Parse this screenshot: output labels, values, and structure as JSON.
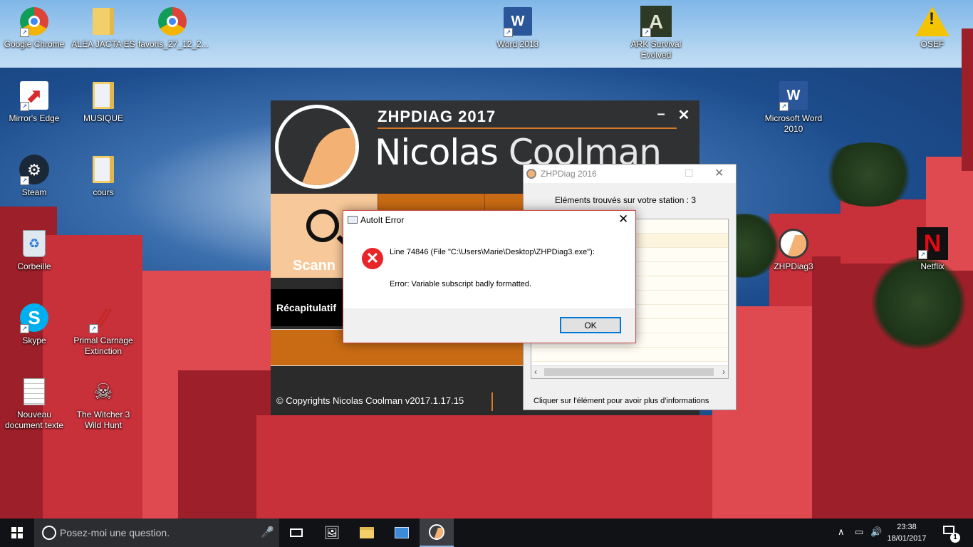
{
  "desktop_icons": [
    {
      "label": "Google Chrome",
      "icon": "chrome-icon"
    },
    {
      "label": "ALEA JACTA ES",
      "icon": "folder-icon"
    },
    {
      "label": "favoris_27_12_2...",
      "icon": "chrome-icon"
    },
    {
      "label": "Word 2013",
      "icon": "word-icon"
    },
    {
      "label": "ARK Survival Evolved",
      "icon": "ark-icon"
    },
    {
      "label": "OSEF",
      "icon": "warning-icon"
    },
    {
      "label": "Mirror's Edge",
      "icon": "mirrors-edge-icon"
    },
    {
      "label": "MUSIQUE",
      "icon": "folder-icon"
    },
    {
      "label": "Microsoft Word 2010",
      "icon": "word-icon"
    },
    {
      "label": "Steam",
      "icon": "steam-icon"
    },
    {
      "label": "cours",
      "icon": "folder-icon"
    },
    {
      "label": "Corbeille",
      "icon": "recycle-bin-icon"
    },
    {
      "label": "ZHPDiag3",
      "icon": "zhpdiag-icon"
    },
    {
      "label": "Netflix",
      "icon": "netflix-icon"
    },
    {
      "label": "Skype",
      "icon": "skype-icon"
    },
    {
      "label": "Primal Carnage Extinction",
      "icon": "primal-carnage-icon"
    },
    {
      "label": "Nouveau document texte",
      "icon": "text-document-icon"
    },
    {
      "label": "The Witcher 3 Wild Hunt",
      "icon": "witcher-icon"
    }
  ],
  "zhp_main": {
    "title": "ZHPDIAG 2017",
    "author_first": "Nicolas",
    "author_last": "Coolman",
    "minimize": "–",
    "close": "✕",
    "tile_scan_label": "Scann",
    "recap_label": "Récapitulatif",
    "copyright": "© Copyrights Nicolas Coolman v2017.1.17.15"
  },
  "zhp_2016": {
    "title": "ZHPDiag 2016",
    "maximize": "☐",
    "close": "✕",
    "found_text": "Eléments trouvés sur votre station : 3",
    "hint": "Cliquer sur l'élément pour avoir plus d'informations",
    "scroll_left": "‹",
    "scroll_right": "›"
  },
  "autoit_error": {
    "title": "AutoIt Error",
    "close": "✕",
    "error_glyph": "✕",
    "line_text": "Line 74846  (File \"C:\\Users\\Marie\\Desktop\\ZHPDiag3.exe\"):",
    "error_text": "Error: Variable subscript badly formatted.",
    "ok_label": "OK"
  },
  "taskbar": {
    "search_placeholder": "Posez-moi une question.",
    "mic": "🎤",
    "tray_chevron": "∧",
    "battery": "▭",
    "volume": "🔊",
    "time": "23:38",
    "date": "18/01/2017",
    "notification_count": "1"
  },
  "colors": {
    "zhp_orange": "#c96b14",
    "zhp_peach": "#f3b274",
    "zhp_dark": "#2f3133",
    "error_red": "#e8262a",
    "ok_focus_blue": "#0078d7",
    "taskbar": "#101216"
  }
}
